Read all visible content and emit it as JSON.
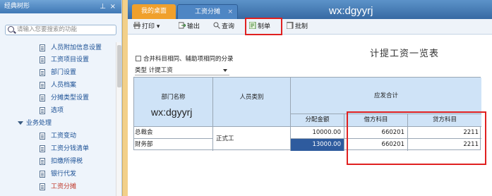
{
  "left_panel": {
    "title": "经典树形",
    "search_placeholder": "请输入您要搜索的功能",
    "items": [
      {
        "label": "人员附加信息设置",
        "type": "leaf"
      },
      {
        "label": "工资项目设置",
        "type": "leaf"
      },
      {
        "label": "部门设置",
        "type": "leaf"
      },
      {
        "label": "人员档案",
        "type": "leaf"
      },
      {
        "label": "分摊类型设置",
        "type": "leaf"
      },
      {
        "label": "选项",
        "type": "leaf"
      },
      {
        "label": "业务处理",
        "type": "folder"
      },
      {
        "label": "工资变动",
        "type": "leaf"
      },
      {
        "label": "工资分钱清单",
        "type": "leaf"
      },
      {
        "label": "扣缴所得税",
        "type": "leaf"
      },
      {
        "label": "银行代发",
        "type": "leaf"
      },
      {
        "label": "工资分摊",
        "type": "leaf",
        "active": true
      }
    ]
  },
  "tabs": [
    {
      "label": "我的桌面"
    },
    {
      "label": "工资分摊"
    }
  ],
  "watermark": "wx:dgyyrj",
  "toolbar": {
    "print": "打印",
    "export": "输出",
    "query": "查询",
    "make_voucher": "制单",
    "batch_make": "批制"
  },
  "report": {
    "title": "计提工资一览表",
    "merge_option": "合并科目相同、辅助项相同的分录",
    "type_label": "类型 计提工资",
    "headers": {
      "dept": "部门名称",
      "person_type": "人员类别",
      "payable_total": "应发合计",
      "alloc_amount": "分配金额",
      "debit_account": "借方科目",
      "credit_account": "贷方科目"
    },
    "rows": [
      {
        "dept": "总裁会",
        "person_type": "正式工",
        "amount": "10000.00",
        "debit": "660201",
        "credit": "2211"
      },
      {
        "dept": "财务部",
        "person_type": "",
        "amount": "13000.00",
        "debit": "660201",
        "credit": "2211"
      }
    ]
  }
}
